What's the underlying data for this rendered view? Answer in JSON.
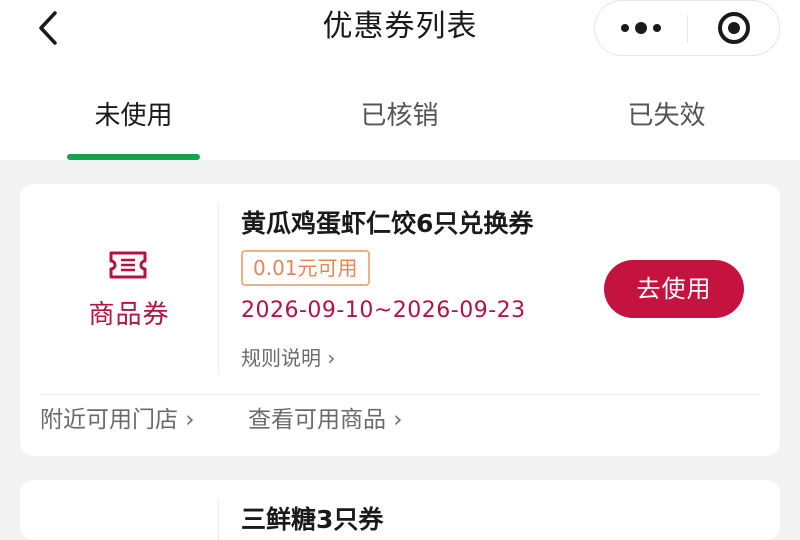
{
  "header": {
    "title": "优惠券列表",
    "back_icon": "chevron-left-icon",
    "more_icon": "more-dots-icon",
    "close_icon": "target-circle-icon"
  },
  "tabs": [
    {
      "label": "未使用",
      "active": true
    },
    {
      "label": "已核销",
      "active": false
    },
    {
      "label": "已失效",
      "active": false
    }
  ],
  "coupons": [
    {
      "type_label": "商品券",
      "type_icon": "ticket-icon",
      "title": "黄瓜鸡蛋虾仁饺6只兑换券",
      "min_spend": "0.01元可用",
      "validity": "2026-09-10~2026-09-23",
      "rules_link": "规则说明 ›",
      "use_button": "去使用",
      "nearby_stores_link": "附近可用门店 ›",
      "view_products_link": "查看可用商品 ›"
    },
    {
      "title": "三鲜糖3只券"
    }
  ],
  "colors": {
    "accent_green": "#1aa04a",
    "brand_red": "#c5133f",
    "badge_orange": "#e3865a"
  }
}
